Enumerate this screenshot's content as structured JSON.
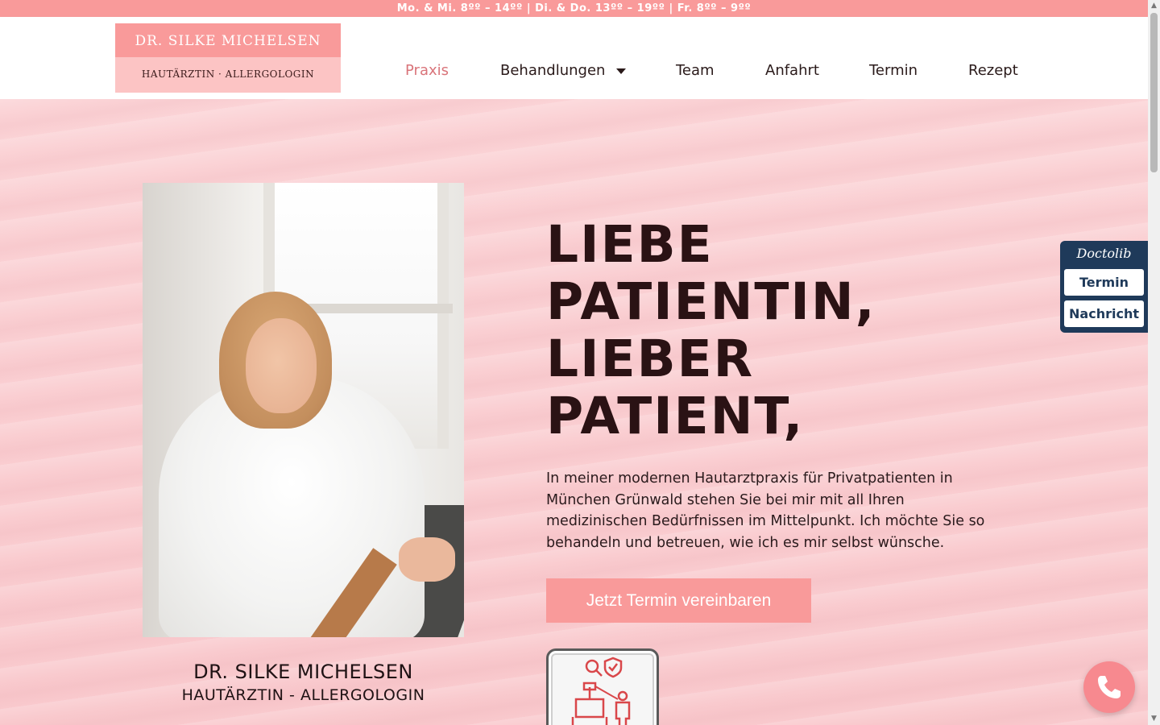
{
  "topbar": {
    "hours": "Mo. & Mi. 8ºº – 14ºº | Di. & Do. 13ºº – 19ºº | Fr. 8ºº – 9ºº"
  },
  "logo": {
    "name": "DR. SILKE MICHELSEN",
    "subtitle": "HAUTÄRZTIN · ALLERGOLOGIN"
  },
  "nav": {
    "items": [
      {
        "label": "Praxis",
        "active": true
      },
      {
        "label": "Behandlungen",
        "dropdown": true
      },
      {
        "label": "Team"
      },
      {
        "label": "Anfahrt"
      },
      {
        "label": "Termin"
      },
      {
        "label": "Rezept"
      }
    ]
  },
  "hero": {
    "headline": [
      "LIEBE",
      "PATIENTIN,",
      "LIEBER",
      "PATIENT,"
    ],
    "intro": "In meiner modernen Hautarztpraxis für Privatpatienten in München Grünwald stehen Sie bei mir mit all Ihren medizinischen Bedürfnissen im Mittelpunkt. Ich möchte Sie so behandeln und betreuen, wie ich es mir selbst wünsche.",
    "cta": "Jetzt Termin vereinbaren",
    "caption_name": "DR. SILKE MICHELSEN",
    "caption_title": "HAUTÄRZTIN - ALLERGOLOGIN"
  },
  "doctolib": {
    "brand": "Doctolib",
    "termin": "Termin",
    "nachricht": "Nachricht"
  },
  "colors": {
    "accent": "#f99a9a",
    "hero_bg": "#fbd3d6",
    "text_dark": "#2a1214",
    "doctolib": "#1f3a5a",
    "phone": "#f7898f"
  },
  "icons": {
    "dropdown": "chevron-down-icon",
    "phone": "phone-icon",
    "badge": "medical-device-icon"
  }
}
